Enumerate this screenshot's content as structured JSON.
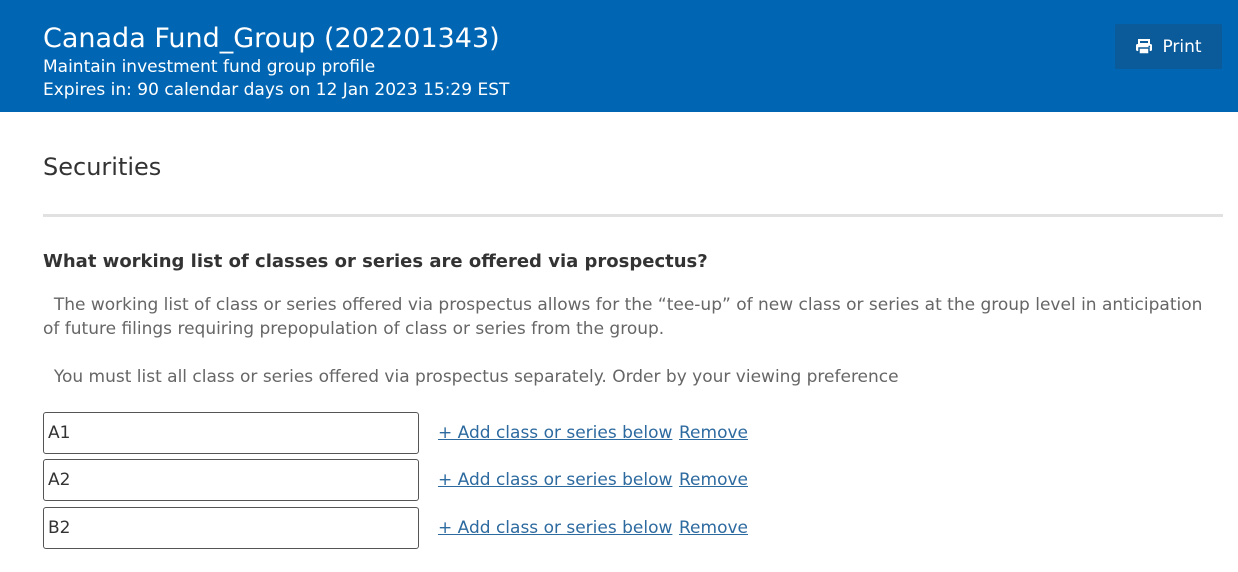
{
  "header": {
    "title": "Canada Fund_Group (202201343)",
    "subtitle": "Maintain investment fund group profile",
    "expiry": "Expires in: 90 calendar days on 12 Jan 2023 15:29 EST",
    "print_label": "Print",
    "print_icon": "printer-icon"
  },
  "colors": {
    "header_bg": "#0066b3",
    "print_bg": "#0b5a99",
    "link": "#2d6a9f"
  },
  "section": {
    "title": "Securities"
  },
  "question": {
    "heading": "What working list of classes or series are offered via prospectus?",
    "description": "  The working list of class or series offered via prospectus allows for the “tee-up” of new class or series at the group level in anticipation of future filings requiring prepopulation of class or series from the group.",
    "instruction": "  You must list all class or series offered via prospectus separately. Order by your viewing preference"
  },
  "rows": [
    {
      "value": "A1",
      "add_label": "+ Add class or series below",
      "remove_label": "Remove"
    },
    {
      "value": "A2",
      "add_label": "+ Add class or series below",
      "remove_label": "Remove"
    },
    {
      "value": "B2",
      "add_label": "+ Add class or series below",
      "remove_label": "Remove"
    }
  ]
}
